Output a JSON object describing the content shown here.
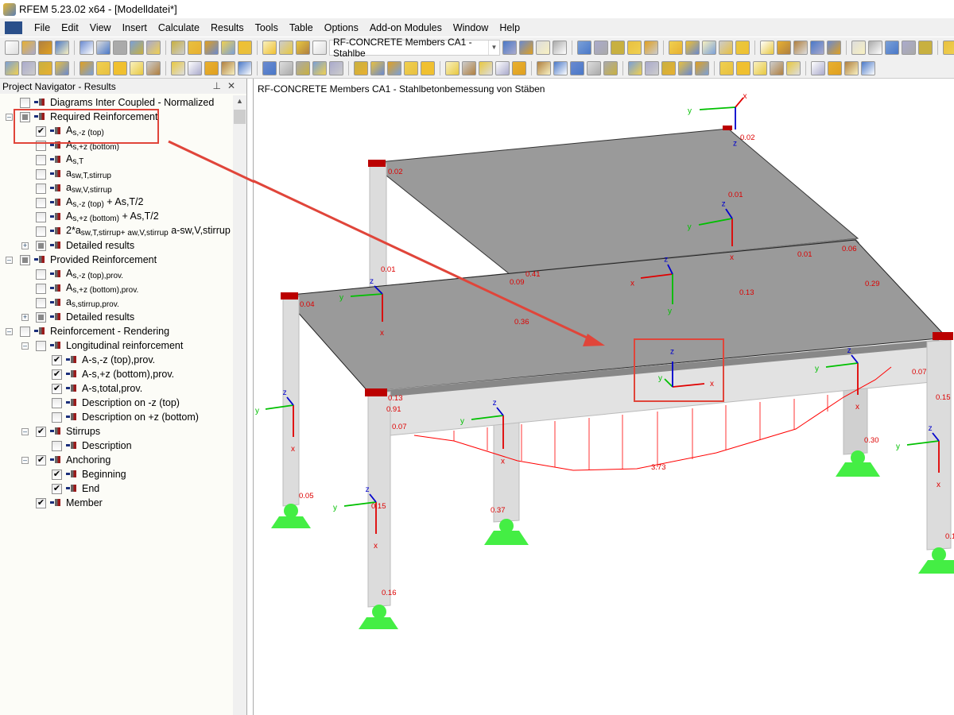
{
  "window": {
    "title": "RFEM 5.23.02 x64 - [Modelldatei*]"
  },
  "menu": [
    "File",
    "Edit",
    "View",
    "Insert",
    "Calculate",
    "Results",
    "Tools",
    "Table",
    "Options",
    "Add-on Modules",
    "Window",
    "Help"
  ],
  "toolbar": {
    "case_combo": "RF-CONCRETE Members CA1 - Stahlbe"
  },
  "navigator": {
    "title": "Project Navigator - Results",
    "items": [
      {
        "main": "Diagrams Inter Coupled - Normalized",
        "sub": "",
        "tail": "",
        "level": 0,
        "state": "off"
      },
      {
        "main": "Required Reinforcement",
        "sub": "",
        "tail": "",
        "level": 0,
        "state": "partial",
        "expander": "-"
      },
      {
        "main": "A",
        "sub": "s,-z (top)",
        "tail": "",
        "level": 1,
        "state": "on"
      },
      {
        "main": "A",
        "sub": "s,+z (bottom)",
        "tail": "",
        "level": 1,
        "state": "off"
      },
      {
        "main": "A",
        "sub": "s,T",
        "tail": "",
        "level": 1,
        "state": "off"
      },
      {
        "main": "a",
        "sub": "sw,T,stirrup",
        "tail": "",
        "level": 1,
        "state": "off"
      },
      {
        "main": "a",
        "sub": "sw,V,stirrup",
        "tail": "",
        "level": 1,
        "state": "off"
      },
      {
        "main": "A",
        "sub": "s,-z (top)",
        "tail": " + As,T/2",
        "level": 1,
        "state": "off"
      },
      {
        "main": "A",
        "sub": "s,+z (bottom)",
        "tail": " + As,T/2",
        "level": 1,
        "state": "off"
      },
      {
        "main": "2*a",
        "sub": "sw,T,stirrup+ aw,V,stirrup",
        "tail": " a-sw,V,stirrup",
        "level": 1,
        "state": "off"
      },
      {
        "main": "Detailed results",
        "sub": "",
        "tail": "",
        "level": 1,
        "state": "partial",
        "expander": "+"
      },
      {
        "main": "Provided Reinforcement",
        "sub": "",
        "tail": "",
        "level": 0,
        "state": "partial",
        "expander": "-"
      },
      {
        "main": "A",
        "sub": "s,-z (top),prov.",
        "tail": "",
        "level": 1,
        "state": "off"
      },
      {
        "main": "A",
        "sub": "s,+z (bottom),prov.",
        "tail": "",
        "level": 1,
        "state": "off"
      },
      {
        "main": "a",
        "sub": "s,stirrup,prov.",
        "tail": "",
        "level": 1,
        "state": "off"
      },
      {
        "main": "Detailed results",
        "sub": "",
        "tail": "",
        "level": 1,
        "state": "partial",
        "expander": "+"
      },
      {
        "main": "Reinforcement - Rendering",
        "sub": "",
        "tail": "",
        "level": 0,
        "state": "off",
        "expander": "-"
      },
      {
        "main": "Longitudinal reinforcement",
        "sub": "",
        "tail": "",
        "level": 1,
        "state": "off",
        "expander": "-"
      },
      {
        "main": "A-s,-z (top),prov.",
        "sub": "",
        "tail": "",
        "level": 2,
        "state": "on"
      },
      {
        "main": "A-s,+z (bottom),prov.",
        "sub": "",
        "tail": "",
        "level": 2,
        "state": "on"
      },
      {
        "main": "A-s,total,prov.",
        "sub": "",
        "tail": "",
        "level": 2,
        "state": "on"
      },
      {
        "main": "Description on -z (top)",
        "sub": "",
        "tail": "",
        "level": 2,
        "state": "off"
      },
      {
        "main": "Description on +z (bottom)",
        "sub": "",
        "tail": "",
        "level": 2,
        "state": "off"
      },
      {
        "main": "Stirrups",
        "sub": "",
        "tail": "",
        "level": 1,
        "state": "on",
        "expander": "-"
      },
      {
        "main": "Description",
        "sub": "",
        "tail": "",
        "level": 2,
        "state": "off"
      },
      {
        "main": "Anchoring",
        "sub": "",
        "tail": "",
        "level": 1,
        "state": "on",
        "expander": "-"
      },
      {
        "main": "Beginning",
        "sub": "",
        "tail": "",
        "level": 2,
        "state": "on"
      },
      {
        "main": "End",
        "sub": "",
        "tail": "",
        "level": 2,
        "state": "on"
      },
      {
        "main": "Member",
        "sub": "",
        "tail": "",
        "level": 1,
        "state": "on"
      }
    ]
  },
  "view": {
    "title": "RF-CONCRETE Members CA1 - Stahlbetonbemessung von Stäben",
    "values": [
      "0.02",
      "0.02",
      "0.01",
      "0.01",
      "0.06",
      "0.01",
      "0.41",
      "0.09",
      "0.13",
      "0.29",
      "0.04",
      "0.36",
      "0.13",
      "0.91",
      "0.07",
      "0.07",
      "0.15",
      "3.73",
      "0.30",
      "0.05",
      "0.15",
      "0.37",
      "0.16",
      "0.1"
    ],
    "axis_labels": {
      "x": "x",
      "y": "y",
      "z": "z"
    },
    "colors": {
      "slab": "#9a9a9a",
      "member": "#dcdcdc",
      "support": "#44ee44",
      "result": "#ff0000",
      "highlight": "#e0453a",
      "x_axis": "#e00000",
      "y_axis": "#00c000",
      "z_axis": "#0000cc"
    }
  }
}
